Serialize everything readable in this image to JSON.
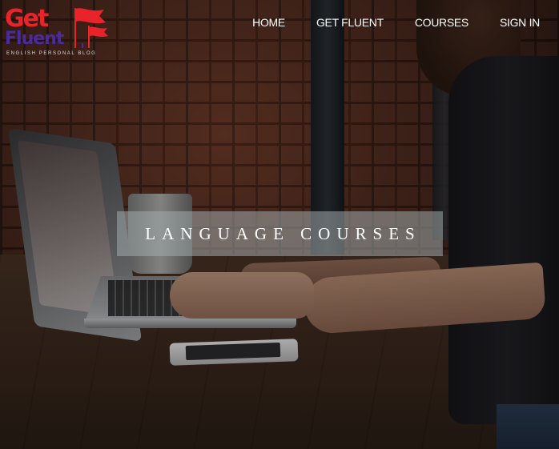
{
  "brand": {
    "name_line1": "Get",
    "name_line2": "Fluent",
    "tagline": "ENGLISH PERSONAL BLOG",
    "primary_color": "#e8242a",
    "secondary_color": "#4a2aa0",
    "icon": "flags-icon"
  },
  "nav": {
    "items": [
      {
        "label": "HOME"
      },
      {
        "label": "GET FLUENT"
      },
      {
        "label": "COURSES"
      },
      {
        "label": "SIGN IN"
      }
    ]
  },
  "hero": {
    "title": "LANGUAGE COURSES",
    "image": "woman typing on laptop at wooden table"
  }
}
